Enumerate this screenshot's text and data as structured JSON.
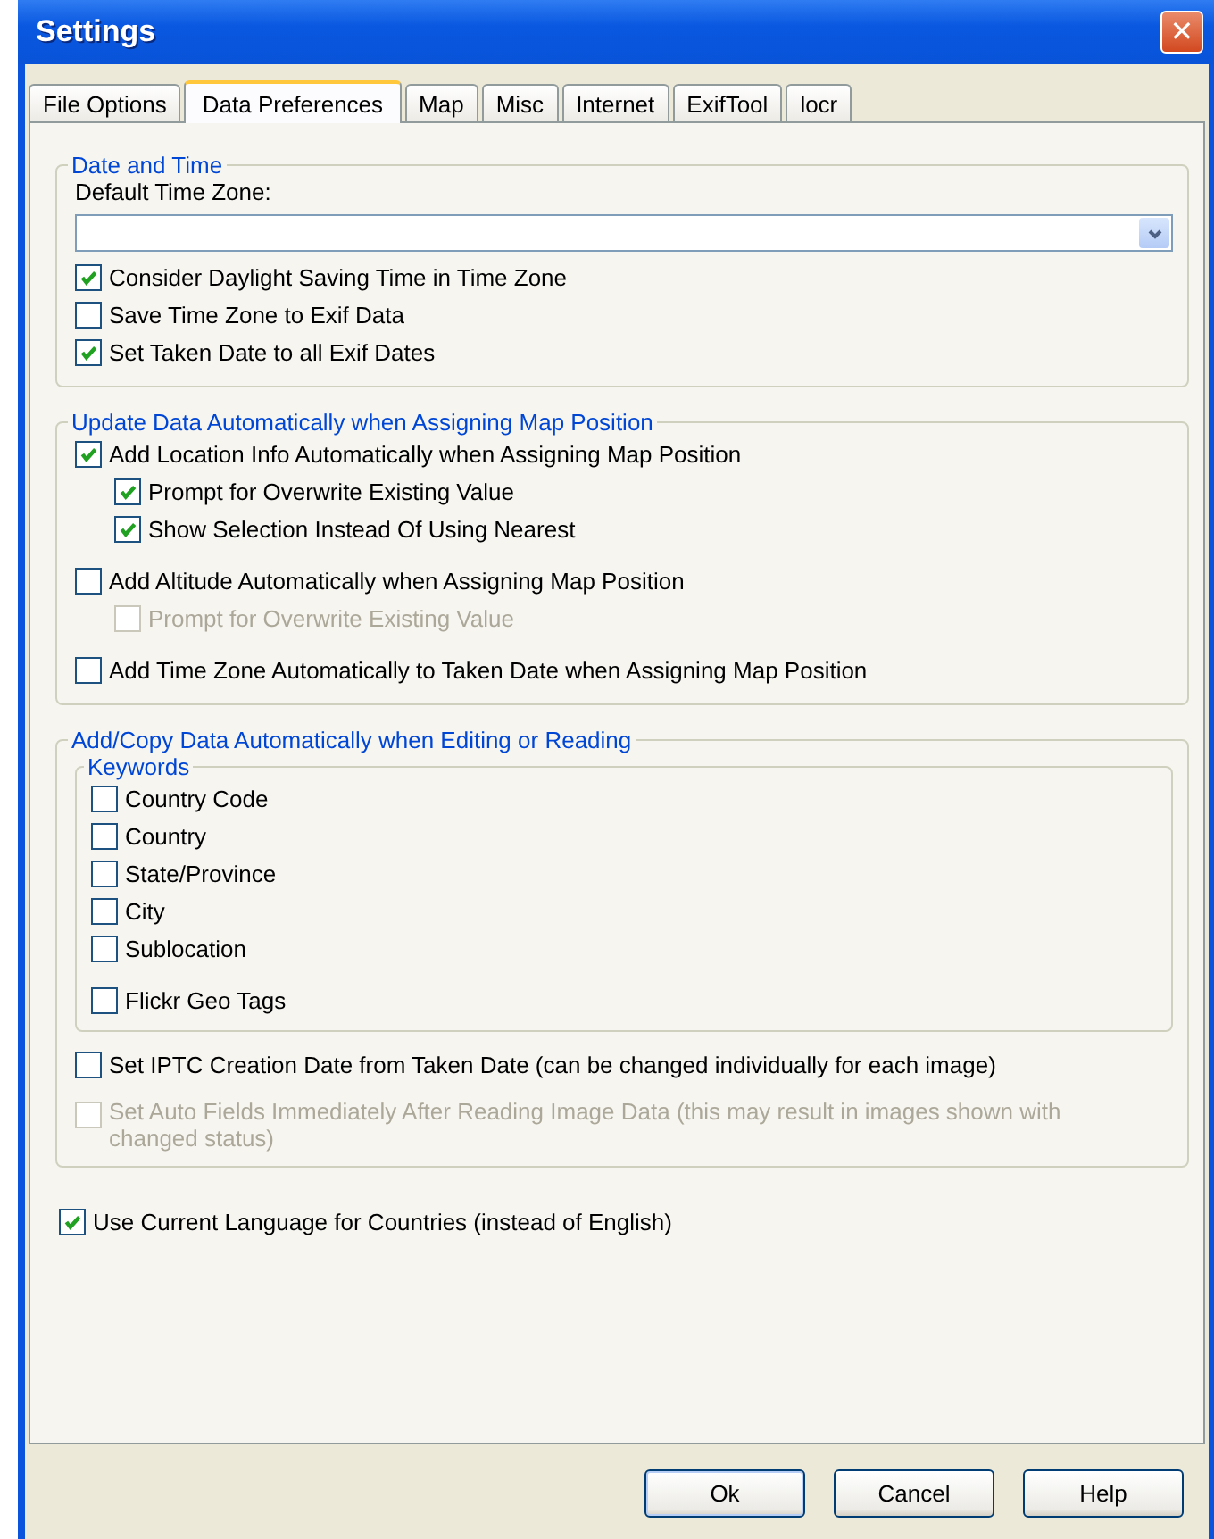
{
  "window": {
    "title": "Settings",
    "close": "✕"
  },
  "tabs": [
    {
      "label": "File Options",
      "selected": false
    },
    {
      "label": "Data Preferences",
      "selected": true
    },
    {
      "label": "Map",
      "selected": false
    },
    {
      "label": "Misc",
      "selected": false
    },
    {
      "label": "Internet",
      "selected": false
    },
    {
      "label": "ExifTool",
      "selected": false
    },
    {
      "label": "locr",
      "selected": false
    }
  ],
  "groups": [
    {
      "title": "Date and Time",
      "items": [
        {
          "kind": "dropdown",
          "label": "Default Time Zone:"
        },
        {
          "kind": "checkbox",
          "label": "Consider Daylight Saving Time in Time Zone",
          "checked": true,
          "disabled": false
        },
        {
          "kind": "checkbox",
          "label": "Save Time Zone to Exif Data",
          "checked": false,
          "disabled": false
        },
        {
          "kind": "checkbox",
          "label": "Set Taken Date to all Exif Dates",
          "checked": true,
          "disabled": false
        }
      ]
    },
    {
      "title": "Update Data Automatically when Assigning Map Position",
      "items": [
        {
          "kind": "checkbox",
          "label": "Add Location Info Automatically when Assigning Map Position",
          "checked": true,
          "disabled": false,
          "children": [
            {
              "kind": "checkbox",
              "label": "Prompt for Overwrite Existing Value",
              "checked": true,
              "disabled": false
            },
            {
              "kind": "checkbox",
              "label": "Show Selection Instead Of Using Nearest",
              "checked": true,
              "disabled": false
            }
          ]
        },
        {
          "kind": "checkbox",
          "label": "Add Altitude Automatically when Assigning Map Position",
          "checked": false,
          "disabled": false,
          "children": [
            {
              "kind": "checkbox",
              "label": "Prompt for Overwrite Existing Value",
              "checked": false,
              "disabled": true
            }
          ]
        },
        {
          "kind": "checkbox",
          "label": "Add Time Zone Automatically to Taken Date when Assigning Map Position",
          "checked": false,
          "disabled": false
        }
      ]
    },
    {
      "title": "Add/Copy Data Automatically when Editing or Reading",
      "items": [
        {
          "kind": "subgroup",
          "title": "Keywords",
          "items": [
            {
              "kind": "checkbox",
              "label": "Country Code",
              "checked": false,
              "disabled": false
            },
            {
              "kind": "checkbox",
              "label": "Country",
              "checked": false,
              "disabled": false
            },
            {
              "kind": "checkbox",
              "label": "State/Province",
              "checked": false,
              "disabled": false
            },
            {
              "kind": "checkbox",
              "label": "City",
              "checked": false,
              "disabled": false
            },
            {
              "kind": "checkbox",
              "label": "Sublocation",
              "checked": false,
              "disabled": false
            },
            {
              "kind": "checkbox",
              "label": "Flickr Geo Tags",
              "checked": false,
              "disabled": false
            }
          ]
        },
        {
          "kind": "checkbox",
          "label": "Set IPTC Creation Date from Taken Date (can be changed individually for each image)",
          "checked": false,
          "disabled": false
        },
        {
          "kind": "checkbox",
          "label": "Set Auto Fields Immediately After Reading Image Data (this may result in images shown with changed status)",
          "checked": false,
          "disabled": true
        }
      ]
    }
  ],
  "options": [
    {
      "kind": "checkbox",
      "label": "Use Current Language for Countries (instead of English)",
      "checked": true,
      "disabled": false
    }
  ],
  "buttons": [
    "Ok",
    "Cancel",
    "Help"
  ]
}
